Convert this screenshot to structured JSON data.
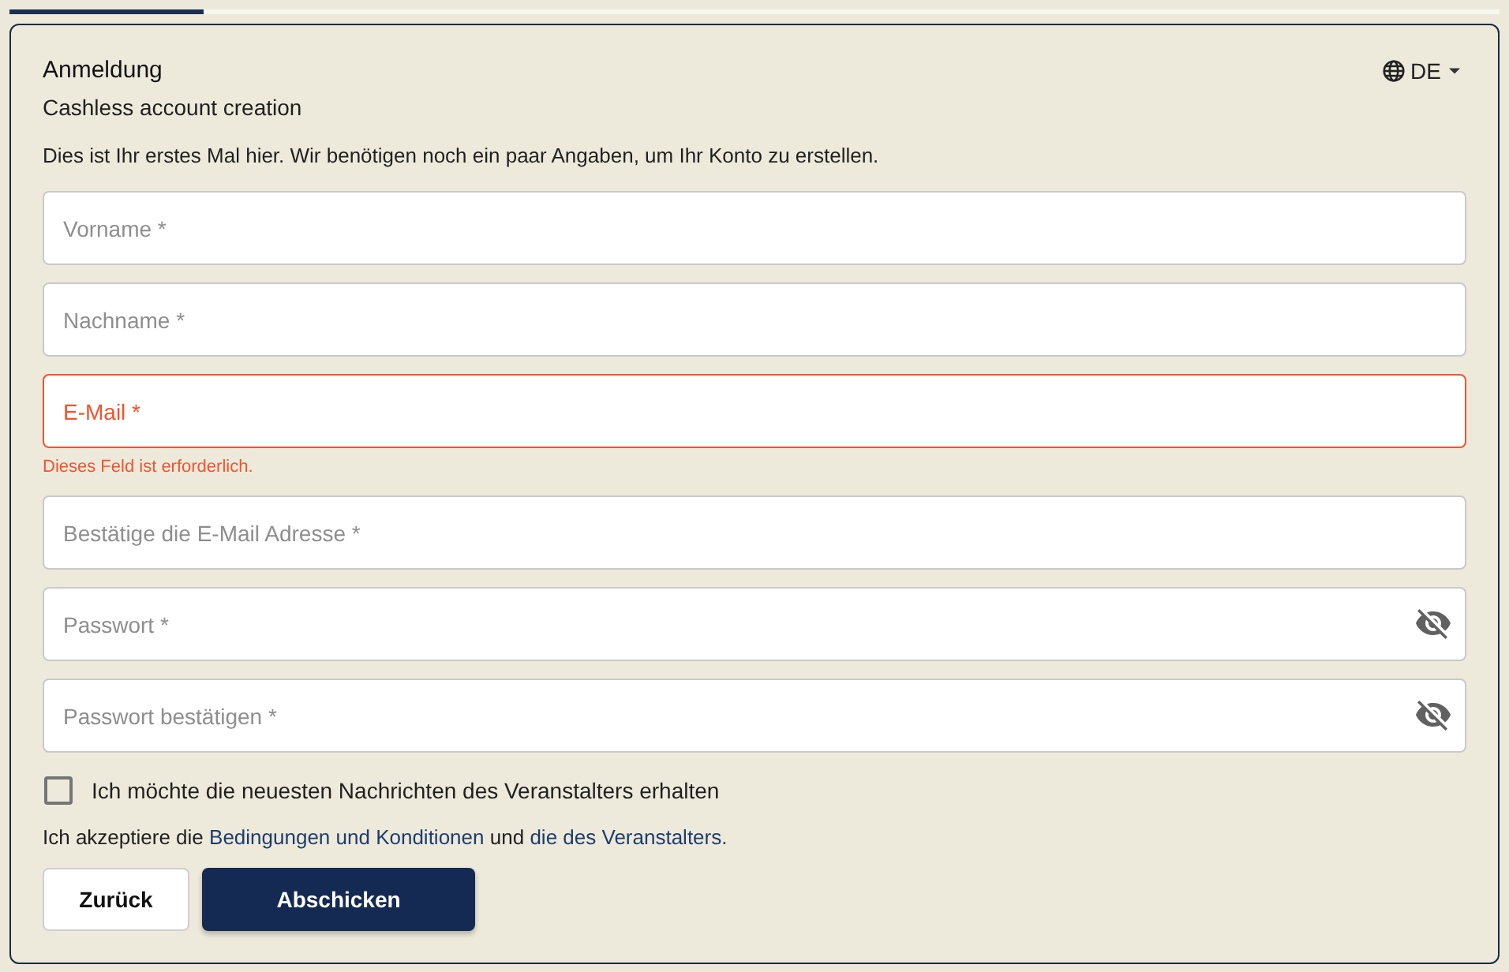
{
  "progress": {
    "level": 0.13
  },
  "header": {
    "title": "Anmeldung",
    "subtitle": "Cashless account creation",
    "language": "DE"
  },
  "intro": "Dies ist Ihr erstes Mal hier. Wir benötigen noch ein paar Angaben, um Ihr Konto zu erstellen.",
  "fields": [
    {
      "kind": "text",
      "placeholder": "Vorname *",
      "invalid": false
    },
    {
      "kind": "text",
      "placeholder": "Nachname *",
      "invalid": false
    },
    {
      "kind": "text",
      "placeholder": "E-Mail *",
      "invalid": true,
      "message": "Dieses Feld ist erforderlich."
    },
    {
      "kind": "text",
      "placeholder": "Bestätige die E-Mail Adresse *",
      "invalid": false
    },
    {
      "kind": "password",
      "placeholder": "Passwort *",
      "invalid": false
    },
    {
      "kind": "password",
      "placeholder": "Passwort bestätigen *",
      "invalid": false
    }
  ],
  "newsletter": {
    "label": "Ich möchte die neuesten Nachrichten des Veranstalters erhalten",
    "checked": false
  },
  "terms": [
    {
      "kind": "text",
      "text": "Ich akzeptiere die"
    },
    {
      "kind": "link",
      "text": "Bedingungen und Konditionen"
    },
    {
      "kind": "text",
      "text": "und"
    },
    {
      "kind": "link",
      "text": "die des Veranstalters."
    }
  ],
  "buttons": [
    {
      "kind": "secondary",
      "label": "Zurück"
    },
    {
      "kind": "primary",
      "label": "Abschicken"
    }
  ]
}
